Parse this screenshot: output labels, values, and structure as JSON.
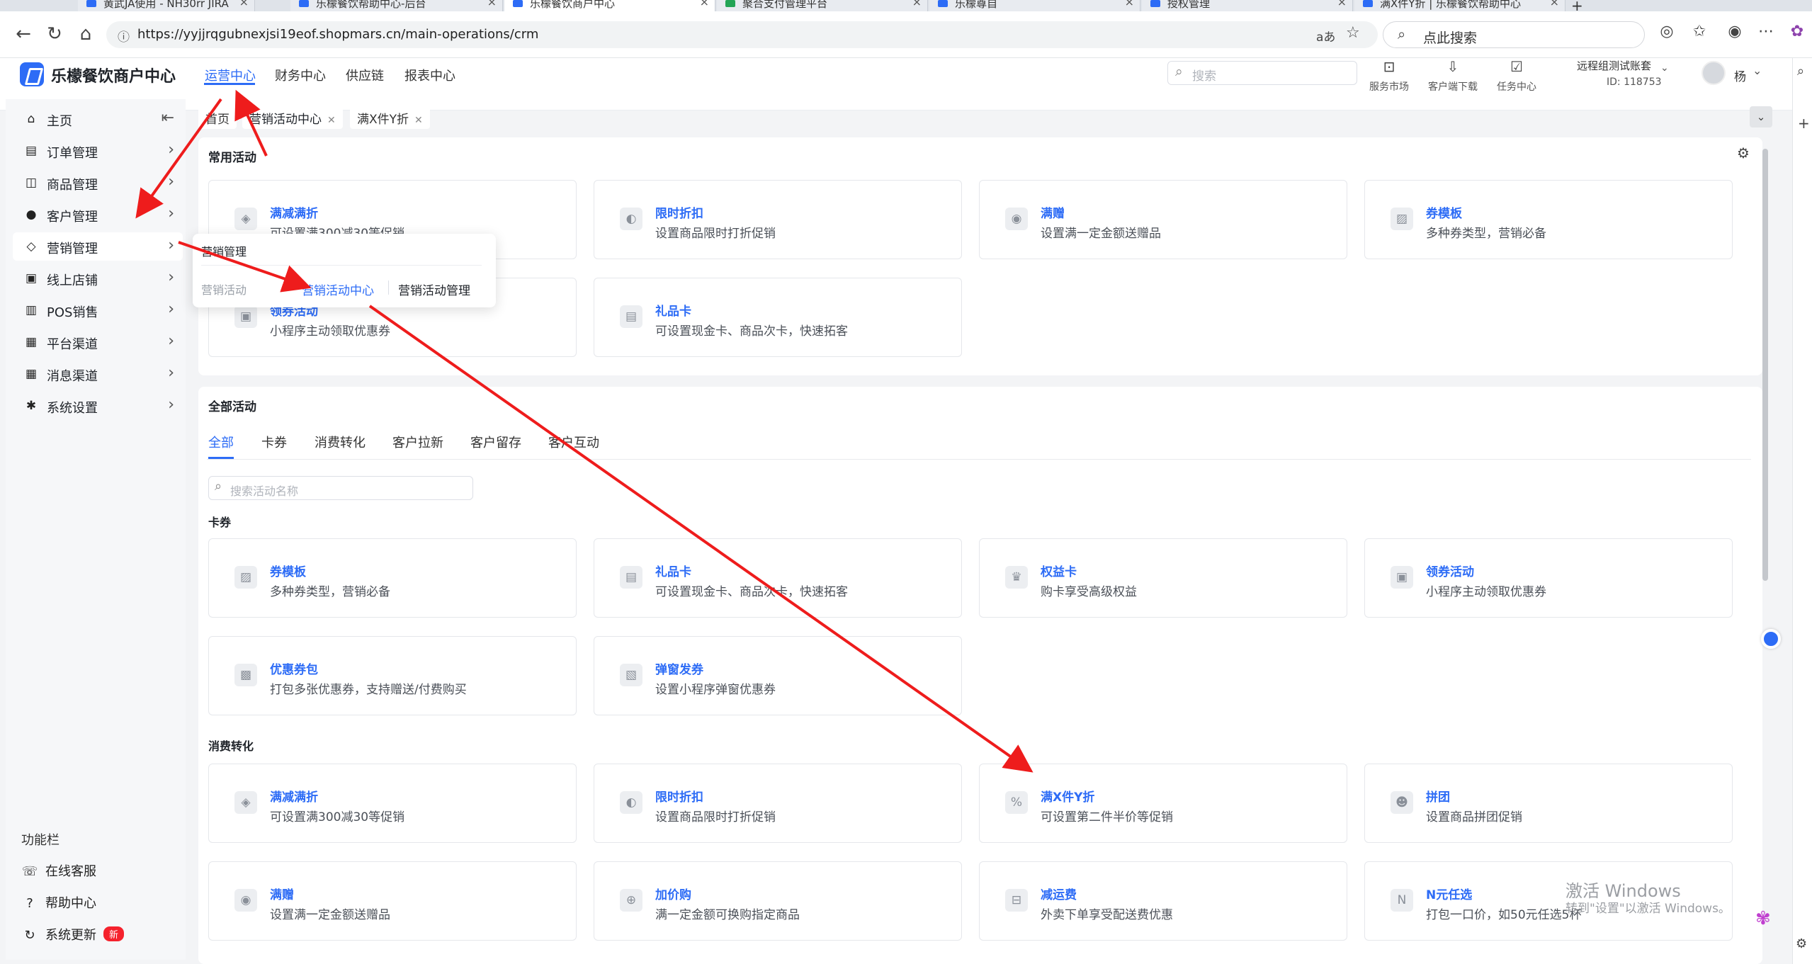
{
  "browser": {
    "tabs": [
      {
        "label": "黄武JA使用 - NH30rr JIRA",
        "left": 0
      },
      {
        "label": "乐檬餐饮帮助中心-后台",
        "left": 0
      },
      {
        "label": "乐檬餐饮商户中心",
        "left": 0
      },
      {
        "label": "聚合支付管理平台",
        "left": 0
      },
      {
        "label": "乐檬尊自",
        "left": 0
      },
      {
        "label": "授权管理",
        "left": 0
      },
      {
        "label": "满X件Y折 | 乐檬餐饮帮助中心",
        "left": 0
      }
    ],
    "url": "https://yyjjrqgubnexjsi19eof.shopmars.cn/main-operations/crm",
    "search_label": "点此搜索",
    "translate_icon": "aあ"
  },
  "app": {
    "title": "乐檬餐饮商户中心",
    "top_nav": [
      "运营中心",
      "财务中心",
      "供应链",
      "报表中心"
    ],
    "search_placeholder": "搜索",
    "tools": [
      {
        "icon": "shop-icon",
        "label": "服务市场"
      },
      {
        "icon": "download-icon",
        "label": "客户端下载"
      },
      {
        "icon": "task-icon",
        "label": "任务中心"
      }
    ],
    "account_name": "远程组测试账套",
    "account_id": "ID: 118753",
    "user_name": "杨"
  },
  "sidebar": {
    "items": [
      {
        "icon": "home-icon",
        "glyph": "⌂",
        "label": "主页"
      },
      {
        "icon": "order-icon",
        "glyph": "▤",
        "label": "订单管理"
      },
      {
        "icon": "goods-icon",
        "glyph": "◫",
        "label": "商品管理"
      },
      {
        "icon": "customer-icon",
        "glyph": "●",
        "label": "客户管理"
      },
      {
        "icon": "tag-icon",
        "glyph": "◇",
        "label": "营销管理"
      },
      {
        "icon": "store-icon",
        "glyph": "▣",
        "label": "线上店铺"
      },
      {
        "icon": "pos-icon",
        "glyph": "▥",
        "label": "POS销售"
      },
      {
        "icon": "channel-icon",
        "glyph": "▦",
        "label": "平台渠道"
      },
      {
        "icon": "message-icon",
        "glyph": "▦",
        "label": "消息渠道"
      },
      {
        "icon": "settings-icon",
        "glyph": "✱",
        "label": "系统设置"
      }
    ],
    "func_title": "功能栏",
    "func_items": [
      {
        "icon": "headset-icon",
        "glyph": "☏",
        "label": "在线客服"
      },
      {
        "icon": "help-icon",
        "glyph": "?",
        "label": "帮助中心"
      },
      {
        "icon": "refresh-icon",
        "glyph": "↻",
        "label": "系统更新"
      }
    ],
    "new_badge": "新"
  },
  "page_tabs": [
    {
      "label": "首页",
      "closable": false
    },
    {
      "label": "营销活动中心",
      "closable": true
    },
    {
      "label": "满X件Y折",
      "closable": true
    }
  ],
  "common": {
    "title": "常用活动",
    "cards": [
      {
        "icon": "tag-icon",
        "glyph": "◈",
        "title": "满减满折",
        "desc": "可设置满300减30等促销"
      },
      {
        "icon": "discount-icon",
        "glyph": "◐",
        "title": "限时折扣",
        "desc": "设置商品限时打折促销"
      },
      {
        "icon": "gift-icon",
        "glyph": "◉",
        "title": "满赠",
        "desc": "设置满一定金额送赠品"
      },
      {
        "icon": "coupon-icon",
        "glyph": "▨",
        "title": "券模板",
        "desc": "多种券类型，营销必备"
      },
      {
        "icon": "coupon-collect-icon",
        "glyph": "▣",
        "title": "领券活动",
        "desc": "小程序主动领取优惠券"
      },
      {
        "icon": "giftcard-icon",
        "glyph": "▤",
        "title": "礼品卡",
        "desc": "可设置现金卡、商品次卡，快速拓客"
      }
    ]
  },
  "all": {
    "title": "全部活动",
    "categories": [
      "全部",
      "卡券",
      "消费转化",
      "客户拉新",
      "客户留存",
      "客户互动"
    ],
    "search_placeholder": "搜索活动名称",
    "sections": [
      {
        "title": "卡券",
        "cards": [
          {
            "icon": "coupon-icon",
            "glyph": "▨",
            "title": "券模板",
            "desc": "多种券类型，营销必备"
          },
          {
            "icon": "giftcard-icon",
            "glyph": "▤",
            "title": "礼品卡",
            "desc": "可设置现金卡、商品次卡，快速拓客"
          },
          {
            "icon": "crown-icon",
            "glyph": "♛",
            "title": "权益卡",
            "desc": "购卡享受高级权益"
          },
          {
            "icon": "coupon-collect-icon",
            "glyph": "▣",
            "title": "领券活动",
            "desc": "小程序主动领取优惠券"
          },
          {
            "icon": "coupon-pack-icon",
            "glyph": "▩",
            "title": "优惠券包",
            "desc": "打包多张优惠券，支持赠送/付费购买"
          },
          {
            "icon": "popup-coupon-icon",
            "glyph": "▧",
            "title": "弹窗发券",
            "desc": "设置小程序弹窗优惠券"
          }
        ]
      },
      {
        "title": "消费转化",
        "cards": [
          {
            "icon": "tag-icon",
            "glyph": "◈",
            "title": "满减满折",
            "desc": "可设置满300减30等促销"
          },
          {
            "icon": "discount-icon",
            "glyph": "◐",
            "title": "限时折扣",
            "desc": "设置商品限时打折促销"
          },
          {
            "icon": "percent-icon",
            "glyph": "%",
            "title": "满X件Y折",
            "desc": "可设置第二件半价等促销"
          },
          {
            "icon": "group-icon",
            "glyph": "☻",
            "title": "拼团",
            "desc": "设置商品拼团促销"
          },
          {
            "icon": "gift-icon",
            "glyph": "◉",
            "title": "满赠",
            "desc": "设置满一定金额送赠品"
          },
          {
            "icon": "cart-icon",
            "glyph": "⊕",
            "title": "加价购",
            "desc": "满一定金额可换购指定商品"
          },
          {
            "icon": "delivery-icon",
            "glyph": "⊟",
            "title": "减运费",
            "desc": "外卖下单享受配送费优惠"
          },
          {
            "icon": "n-choice-icon",
            "glyph": "N",
            "title": "N元任选",
            "desc": "打包一口价，如50元任选5杯"
          }
        ]
      }
    ]
  },
  "popup": {
    "title": "营销管理",
    "group_label": "营销活动",
    "links": [
      "营销活动中心",
      "营销活动管理"
    ]
  },
  "watermark": {
    "line1": "激活 Windows",
    "line2": "转到\"设置\"以激活 Windows。"
  },
  "colors": {
    "accent": "#2d6cf6",
    "annotation_arrow": "#ee1c1c"
  }
}
